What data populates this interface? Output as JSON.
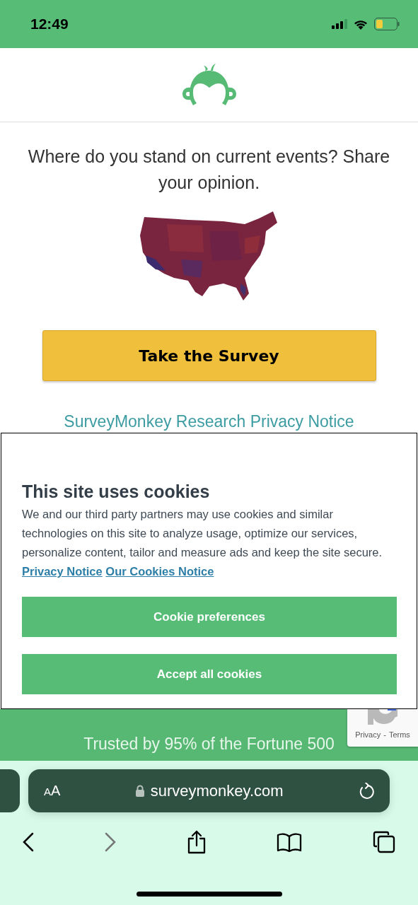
{
  "status_bar": {
    "time": "12:49"
  },
  "survey": {
    "headline": "Where do you stand on current events? Share your opinion.",
    "button": "Take the Survey",
    "privacy_link": "SurveyMonkey Research Privacy Notice"
  },
  "cookie_banner": {
    "title": "This site uses cookies",
    "body": "We and our third party partners may use cookies and similar technologies on this site to analyze usage, optimize our services, personalize content, tailor and measure ads and keep the site secure.",
    "links": [
      "Privacy Notice",
      "Our Cookies Notice"
    ],
    "buttons": [
      "Cookie preferences",
      "Accept all cookies"
    ]
  },
  "footer": {
    "tagline": "Trusted by 95% of the Fortune 500"
  },
  "recaptcha": {
    "links": [
      "Privacy",
      "Terms"
    ],
    "separator": "-"
  },
  "browser": {
    "text_size": "AA",
    "url": "surveymonkey.com",
    "toolbar": [
      {
        "kind": "back",
        "disabled": false
      },
      {
        "kind": "forward",
        "disabled": true
      },
      {
        "kind": "share",
        "disabled": false
      },
      {
        "kind": "bookmarks",
        "disabled": false
      },
      {
        "kind": "tabs",
        "disabled": false
      }
    ]
  }
}
